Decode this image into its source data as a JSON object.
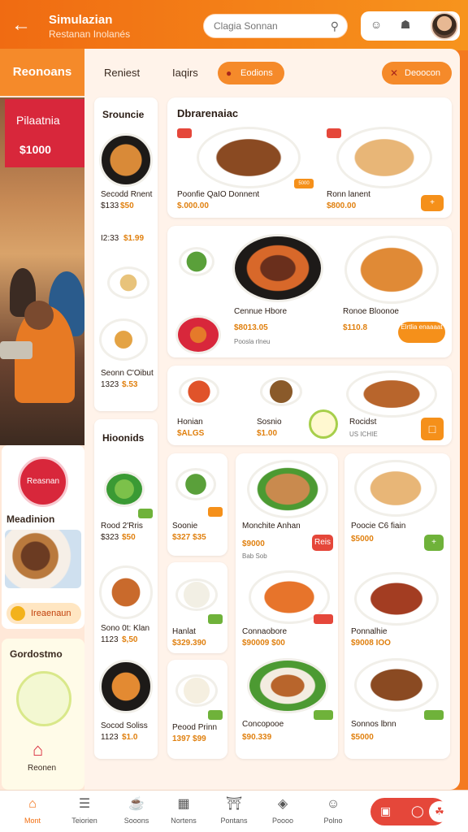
{
  "header": {
    "title": "Simulazian",
    "subtitle": "Restanan Inolanés",
    "search_placeholder": "Clagia Sonnan",
    "icons": [
      "back-arrow-icon",
      "search-icon",
      "face-icon",
      "bag-icon"
    ]
  },
  "sidebar": {
    "title": "Reonoans",
    "promo_title": "Pilaatnia",
    "promo_price": "$1000",
    "circle_label": "Reasnan",
    "section_label": "Meadinion",
    "pill_label": "Ireaenaun",
    "card2_label_prefix": "G",
    "card2_label": "Gordostmo",
    "card2_bottom": "Reonen"
  },
  "tabs": {
    "tab1": "Reniest",
    "tab2": "Iaqirs",
    "pill1": "Eodions",
    "pill2": "Deoocon"
  },
  "categories": {
    "col1_title": "Srouncie",
    "col2_title": "Hioonids"
  },
  "feature": {
    "title": "Dbrarenaiac"
  },
  "dishes": {
    "c1a": {
      "name": "Secodd Rnent",
      "price1": "$133",
      "price2": "$50"
    },
    "c1b": {
      "name": "I2:33",
      "price": "$1.99"
    },
    "c1c": {
      "name": "Seonn C'Oibut",
      "price1": "1323",
      "price2": "$.53"
    },
    "c1d": {
      "name": "Rood 2'Rris",
      "price1": "$323",
      "price2": "$50"
    },
    "c1e": {
      "name": "Sono 0t: Klan",
      "price": "1123",
      "price2": "$,50"
    },
    "c1f": {
      "name": "Socod Soliss",
      "price": "1123",
      "price2": "$1.0"
    },
    "f1": {
      "name": "Poonfie QaIO Donnent",
      "price": "$.000.00",
      "tag": "5000"
    },
    "f2": {
      "name": "Ronn lanent",
      "price": "$800.00"
    },
    "f3": {
      "name": "Cennue Hbore",
      "price": "$8013.05",
      "sub": "Poosla rlneu"
    },
    "f4": {
      "name": "Ronoe Bloonoe",
      "price": "$110.8",
      "btn": "Elrtlia enaaaat"
    },
    "s1": {
      "name": "Honian",
      "price": "$ALGS"
    },
    "s2": {
      "name": "Sosnio",
      "price": "$1.00"
    },
    "s3": {
      "name": "Rocidst",
      "sub": "US ICHIE"
    },
    "g1": {
      "name": "Soonie",
      "price": "$327 $35"
    },
    "g2": {
      "name": "Monchite Anhan",
      "price": "$9000",
      "sub": "Bab Sob",
      "tag": "Reis"
    },
    "g3": {
      "name": "Poocie C6 fiain",
      "price": "$5000"
    },
    "g4": {
      "name": "Hanlat",
      "price": "$329.390"
    },
    "g5": {
      "name": "Connaobore",
      "price": "$90009 $00"
    },
    "g6": {
      "name": "Ponnalhie",
      "price": "$9008 IOO"
    },
    "g7": {
      "name": "Peood Prinn",
      "price": "1397 $99"
    },
    "g8": {
      "name": "Concopooe",
      "price": "$90.339"
    },
    "g9": {
      "name": "Sonnos lbnn",
      "price": "$5000"
    }
  },
  "bottom_nav": [
    {
      "label": "Mont",
      "icon": "home-icon"
    },
    {
      "label": "Teiorien",
      "icon": "list-icon"
    },
    {
      "label": "Sooons",
      "icon": "chef-icon"
    },
    {
      "label": "Nortens",
      "icon": "calendar-icon"
    },
    {
      "label": "Pontans",
      "icon": "building-icon"
    },
    {
      "label": "Poooo",
      "icon": "gift-icon"
    },
    {
      "label": "Polno",
      "icon": "face-icon"
    }
  ],
  "colors": {
    "brand_orange": "#f47a1f",
    "accent_red": "#d8273b",
    "accent_green": "#6fb23a"
  }
}
